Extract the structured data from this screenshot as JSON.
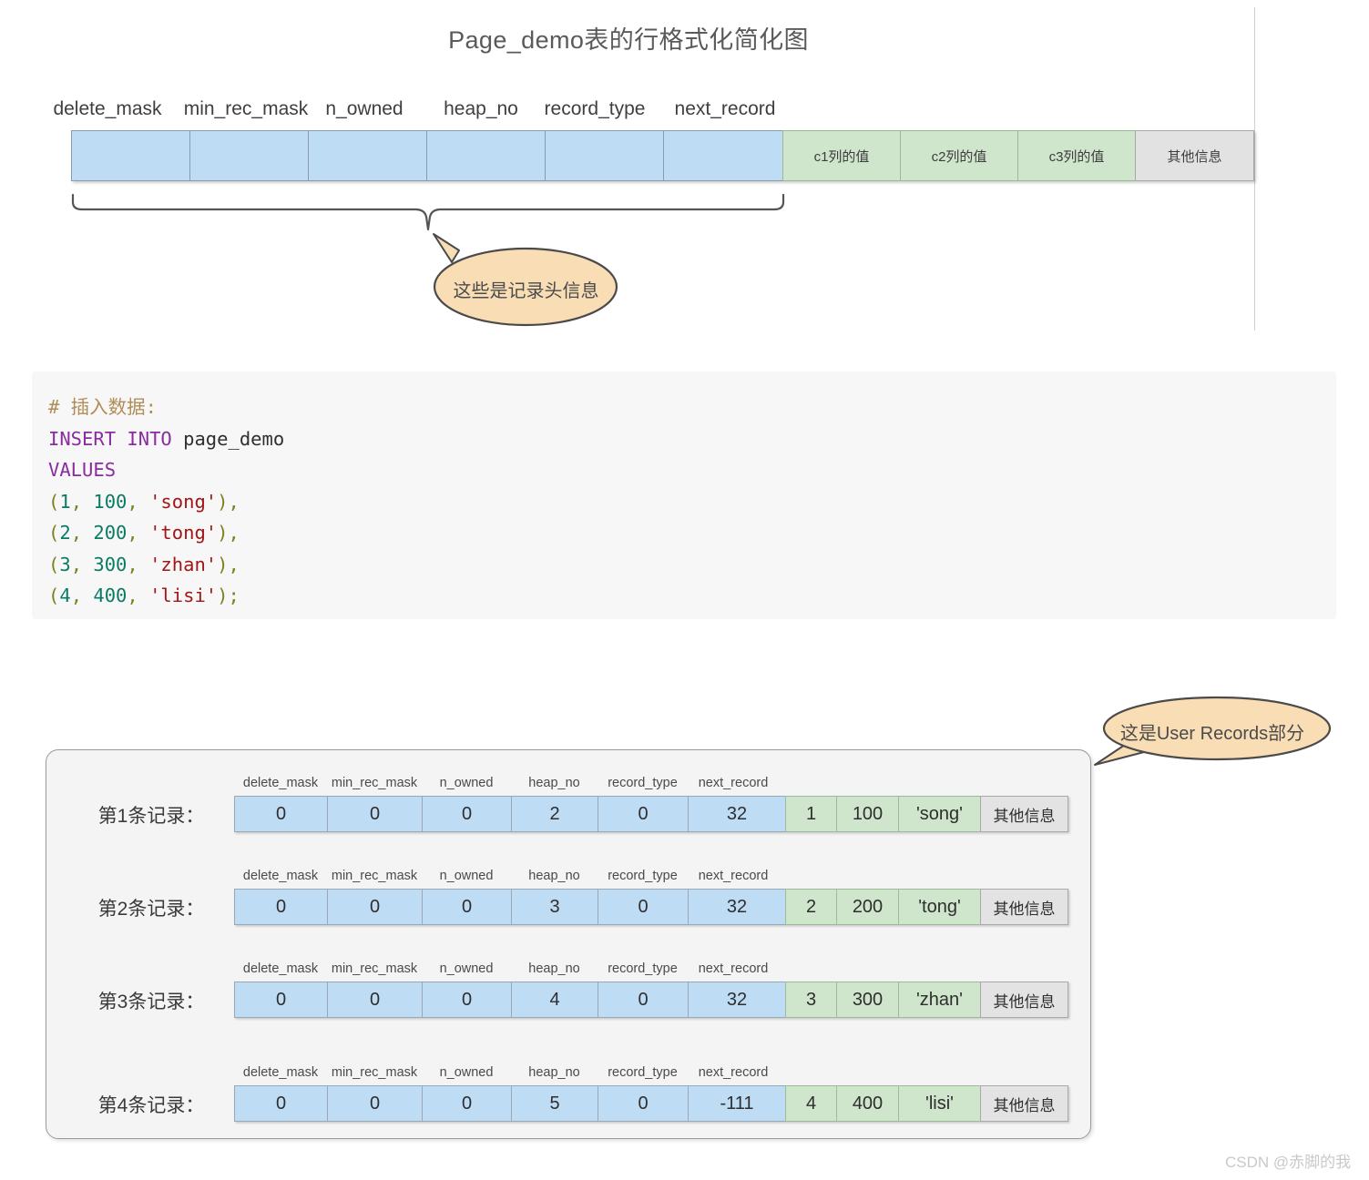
{
  "top_diagram": {
    "title": "Page_demo表的行格式化简化图",
    "header_labels": [
      "delete_mask",
      "min_rec_mask",
      "n_owned",
      "heap_no",
      "record_type",
      "next_record"
    ],
    "column_cells": [
      "c1列的值",
      "c2列的值",
      "c3列的值"
    ],
    "other_cell": "其他信息",
    "callout": "这些是记录头信息"
  },
  "code": {
    "comment": "# 插入数据:",
    "kw_insert": "INSERT INTO",
    "table": "page_demo",
    "kw_values": "VALUES",
    "rows": [
      {
        "open": "(",
        "id": "1",
        "c1": "100",
        "c2": "'song'",
        "close": "),"
      },
      {
        "open": "(",
        "id": "2",
        "c1": "200",
        "c2": "'tong'",
        "close": "),"
      },
      {
        "open": "(",
        "id": "3",
        "c1": "300",
        "c2": "'zhan'",
        "close": "),"
      },
      {
        "open": "(",
        "id": "4",
        "c1": "400",
        "c2": "'lisi'",
        "close": ");"
      }
    ],
    "comma": ", "
  },
  "records_section": {
    "callout": "这是User Records部分",
    "headers": [
      "delete_mask",
      "min_rec_mask",
      "n_owned",
      "heap_no",
      "record_type",
      "next_record"
    ],
    "other_label": "其他信息",
    "rows": [
      {
        "label": "第1条记录：",
        "header_values": [
          "0",
          "0",
          "0",
          "2",
          "0",
          "32"
        ],
        "column_values": [
          "1",
          "100",
          "'song'"
        ],
        "other": "其他信息"
      },
      {
        "label": "第2条记录：",
        "header_values": [
          "0",
          "0",
          "0",
          "3",
          "0",
          "32"
        ],
        "column_values": [
          "2",
          "200",
          "'tong'"
        ],
        "other": "其他信息"
      },
      {
        "label": "第3条记录：",
        "header_values": [
          "0",
          "0",
          "0",
          "4",
          "0",
          "32"
        ],
        "column_values": [
          "3",
          "300",
          "'zhan'"
        ],
        "other": "其他信息"
      },
      {
        "label": "第4条记录：",
        "header_values": [
          "0",
          "0",
          "0",
          "5",
          "0",
          "-111"
        ],
        "column_values": [
          "4",
          "400",
          "'lisi'"
        ],
        "other": "其他信息"
      }
    ]
  },
  "watermark": "CSDN @赤脚的我",
  "colors": {
    "header_cell": "#bfdcf5",
    "column_cell": "#cfe6cc",
    "other_cell": "#e2e2e2",
    "bubble_fill": "#f8ddb5",
    "bubble_stroke": "#4a4a4a",
    "code_bg": "#f7f7f8",
    "box_bg": "#f4f4f4"
  }
}
